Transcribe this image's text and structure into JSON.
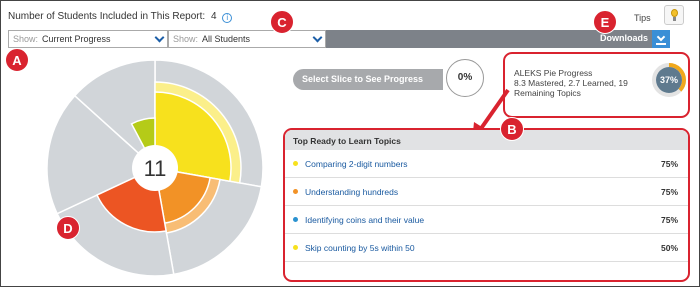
{
  "header": {
    "students_label": "Number of Students Included in This Report:",
    "students_count": "4",
    "tips_label": "Tips"
  },
  "toolbar": {
    "show_label_1": "Show:",
    "show_value_1": "Current Progress",
    "show_label_2": "Show:",
    "show_value_2": "All Students",
    "downloads_label": "Downloads"
  },
  "badges": {
    "a": "A",
    "b": "B",
    "c": "C",
    "d": "D",
    "e": "E"
  },
  "pie": {
    "center_label": "11",
    "colors": {
      "yellow": "#f7e11d",
      "light_yellow": "#fbef8a",
      "orange": "#f29226",
      "light_orange": "#f8bd75",
      "red": "#ec5523",
      "green": "#b5cb18",
      "grey": "#d1d5d9"
    }
  },
  "slice": {
    "prompt": "Select Slice to See Progress",
    "percent": "0%"
  },
  "aleks_progress": {
    "title": "ALEKS Pie Progress",
    "detail_line_1": "8.3 Mastered, 2.7 Learned, 19",
    "detail_line_2": "Remaining Topics",
    "percent": "37%",
    "percent_value": 37,
    "ring_color": "#f0a81c",
    "center_color": "#5f7a8e"
  },
  "topics": {
    "header": "Top Ready to Learn Topics",
    "items": [
      {
        "name": "Comparing 2-digit numbers",
        "percent": "75%",
        "dot_color": "#f7e11d"
      },
      {
        "name": "Understanding hundreds",
        "percent": "75%",
        "dot_color": "#f29226"
      },
      {
        "name": "Identifying coins and their value",
        "percent": "75%",
        "dot_color": "#2a92d0"
      },
      {
        "name": "Skip counting by 5s within 50",
        "percent": "50%",
        "dot_color": "#f7e11d"
      }
    ]
  }
}
